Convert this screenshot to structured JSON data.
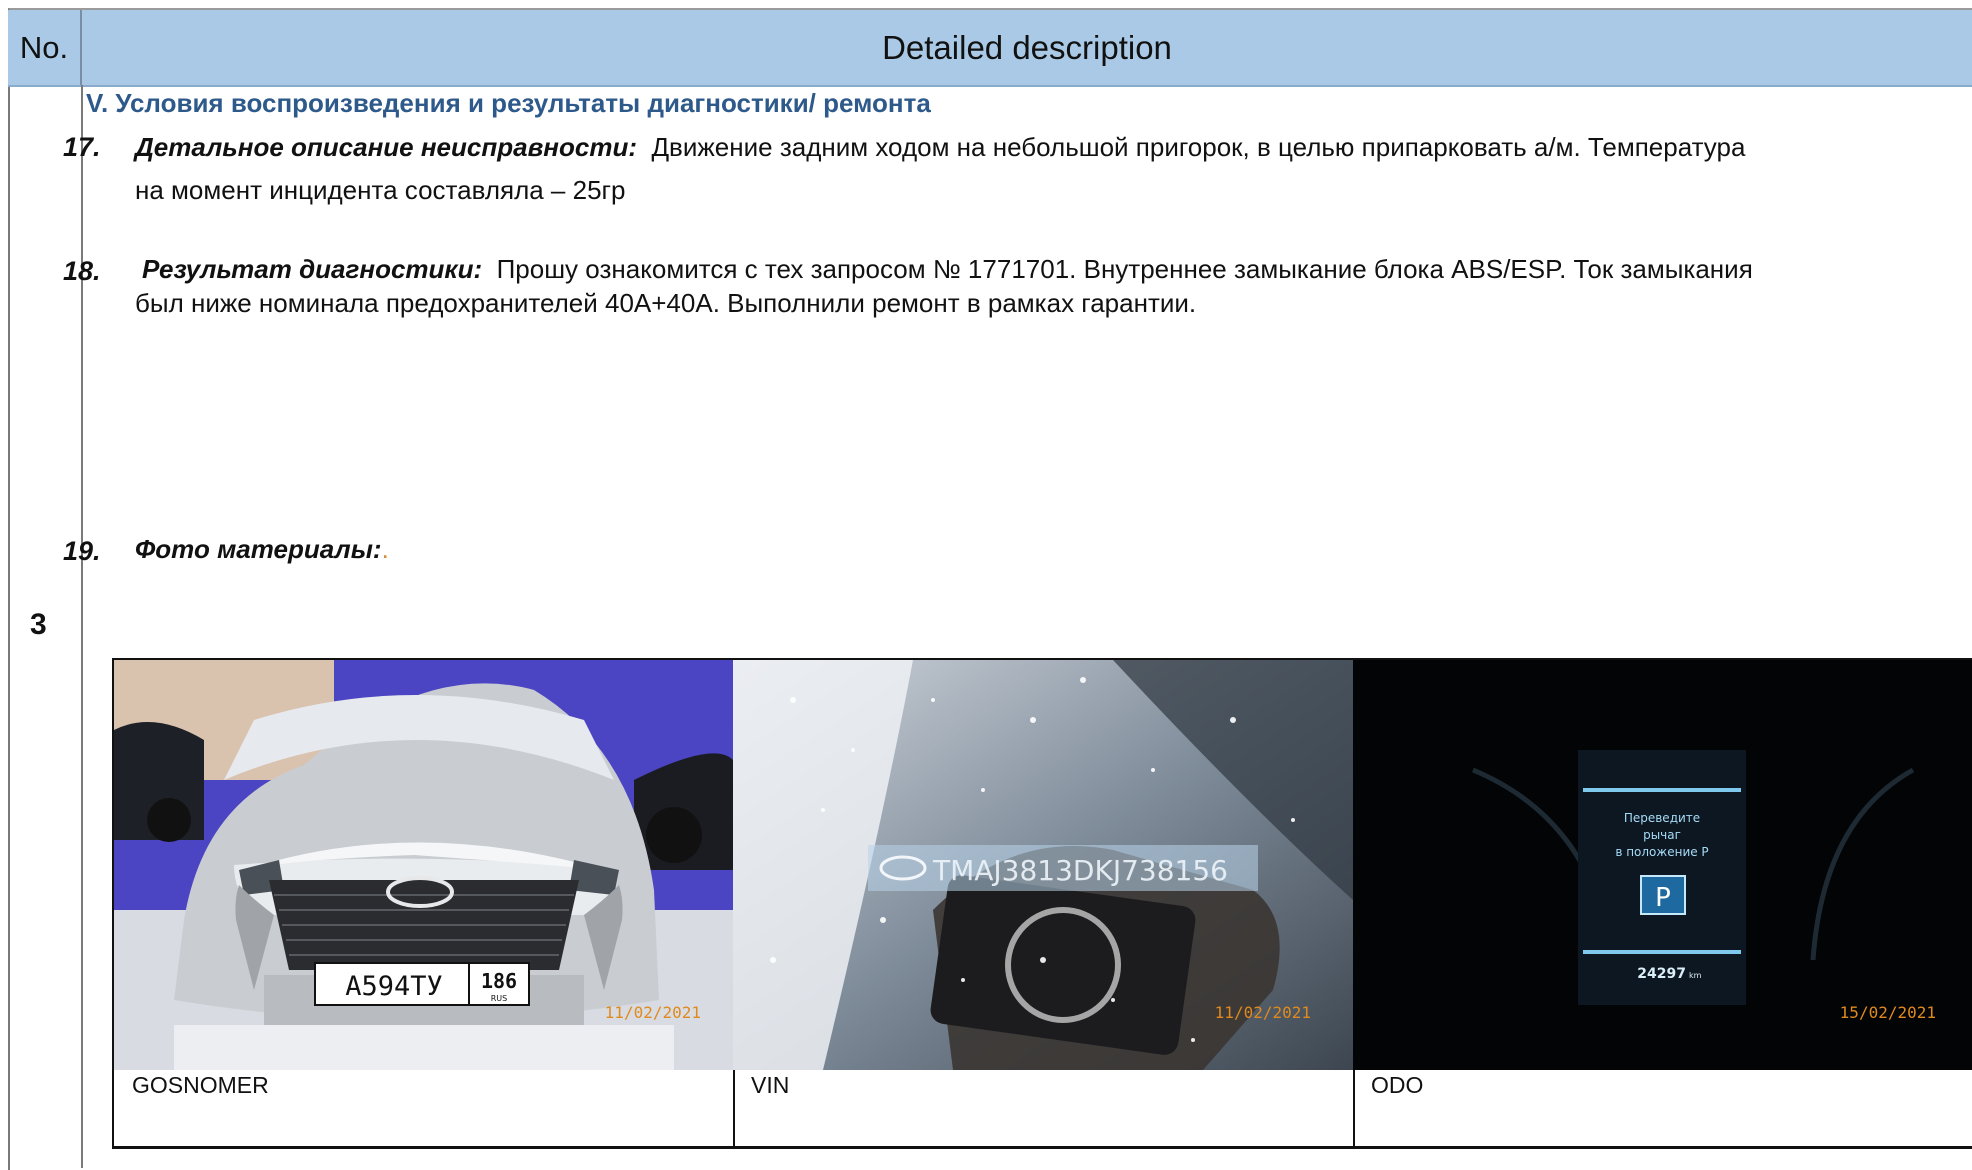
{
  "header": {
    "no_label": "No.",
    "title": "Detailed description"
  },
  "row_number": "3",
  "section_title": "V. Условия воспроизведения и результаты диагностики/ ремонта",
  "items": [
    {
      "number": "17.",
      "label": "Детальное описание неисправности:",
      "text_line1": "Движение задним ходом на небольшой пригорок, в целью припарковать а/м. Температура",
      "text_line2": "на момент инцидента составляла – 25гр"
    },
    {
      "number": "18.",
      "label": "Результат диагностики:",
      "text_line1": "Прошу ознакомится с тех запросом № 1771701. Внутреннее замыкание блока ABS/ESP. Ток   замыкания",
      "text_line2": "был ниже номинала предохранителей 40А+40А. Выполнили ремонт в рамках гарантии."
    },
    {
      "number": "19.",
      "label": "Фото материалы:",
      "suffix": "."
    }
  ],
  "photos": [
    {
      "caption": "GOSNOMER",
      "date_stamp": "11/02/2021",
      "plate_main": "А594ТУ",
      "plate_region": "186",
      "plate_country": "RUS"
    },
    {
      "caption": "VIN",
      "date_stamp": "11/02/2021",
      "vin_text": "TMAJ3813DKJ738156"
    },
    {
      "caption": "ODO",
      "date_stamp": "15/02/2021",
      "screen_line1": "Переведите",
      "screen_line2": "рычаг",
      "screen_line3": "в положение Р",
      "gear": "P",
      "odometer": "24297",
      "odometer_unit": "km"
    }
  ],
  "colors": {
    "header_bg": "#a9c9e6",
    "section_title": "#2e5a8b",
    "date_stamp": "#e08a1e",
    "accent_dot": "#d98a3a"
  }
}
